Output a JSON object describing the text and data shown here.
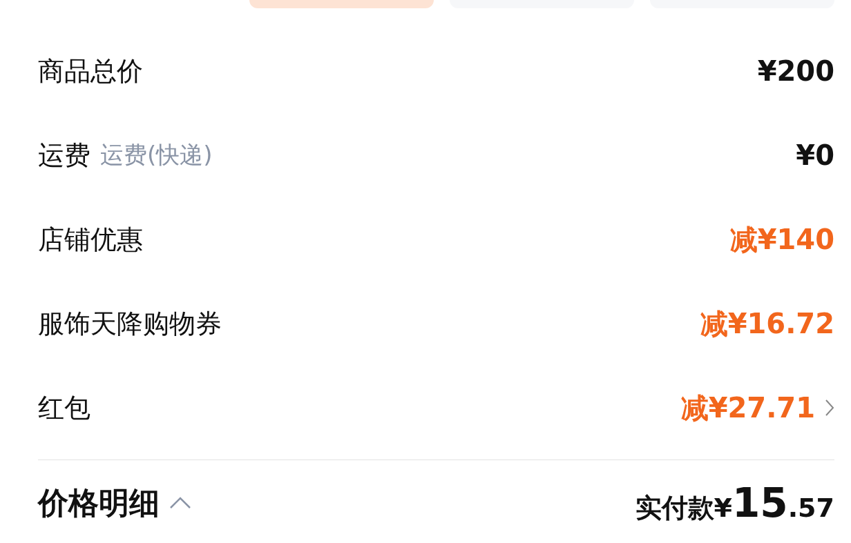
{
  "top_tabs": [
    {
      "selected": true
    },
    {
      "selected": false
    },
    {
      "selected": false
    }
  ],
  "rows": [
    {
      "label": "商品总价",
      "amount": "¥200",
      "kind": "total",
      "expandable": false
    },
    {
      "label": "运费",
      "note": "运费(快递)",
      "amount": "¥0",
      "kind": "total",
      "expandable": false
    },
    {
      "label": "店铺优惠",
      "amount": "减¥140",
      "kind": "discount",
      "expandable": false
    },
    {
      "label": "服饰天降购物券",
      "amount": "减¥16.72",
      "kind": "discount",
      "expandable": false
    },
    {
      "label": "红包",
      "amount": "减¥27.71",
      "kind": "discount",
      "expandable": true
    }
  ],
  "footer": {
    "title": "价格明细",
    "expanded": true,
    "pay_label": "实付款¥",
    "pay_integer": "15",
    "pay_decimal": ".57"
  }
}
